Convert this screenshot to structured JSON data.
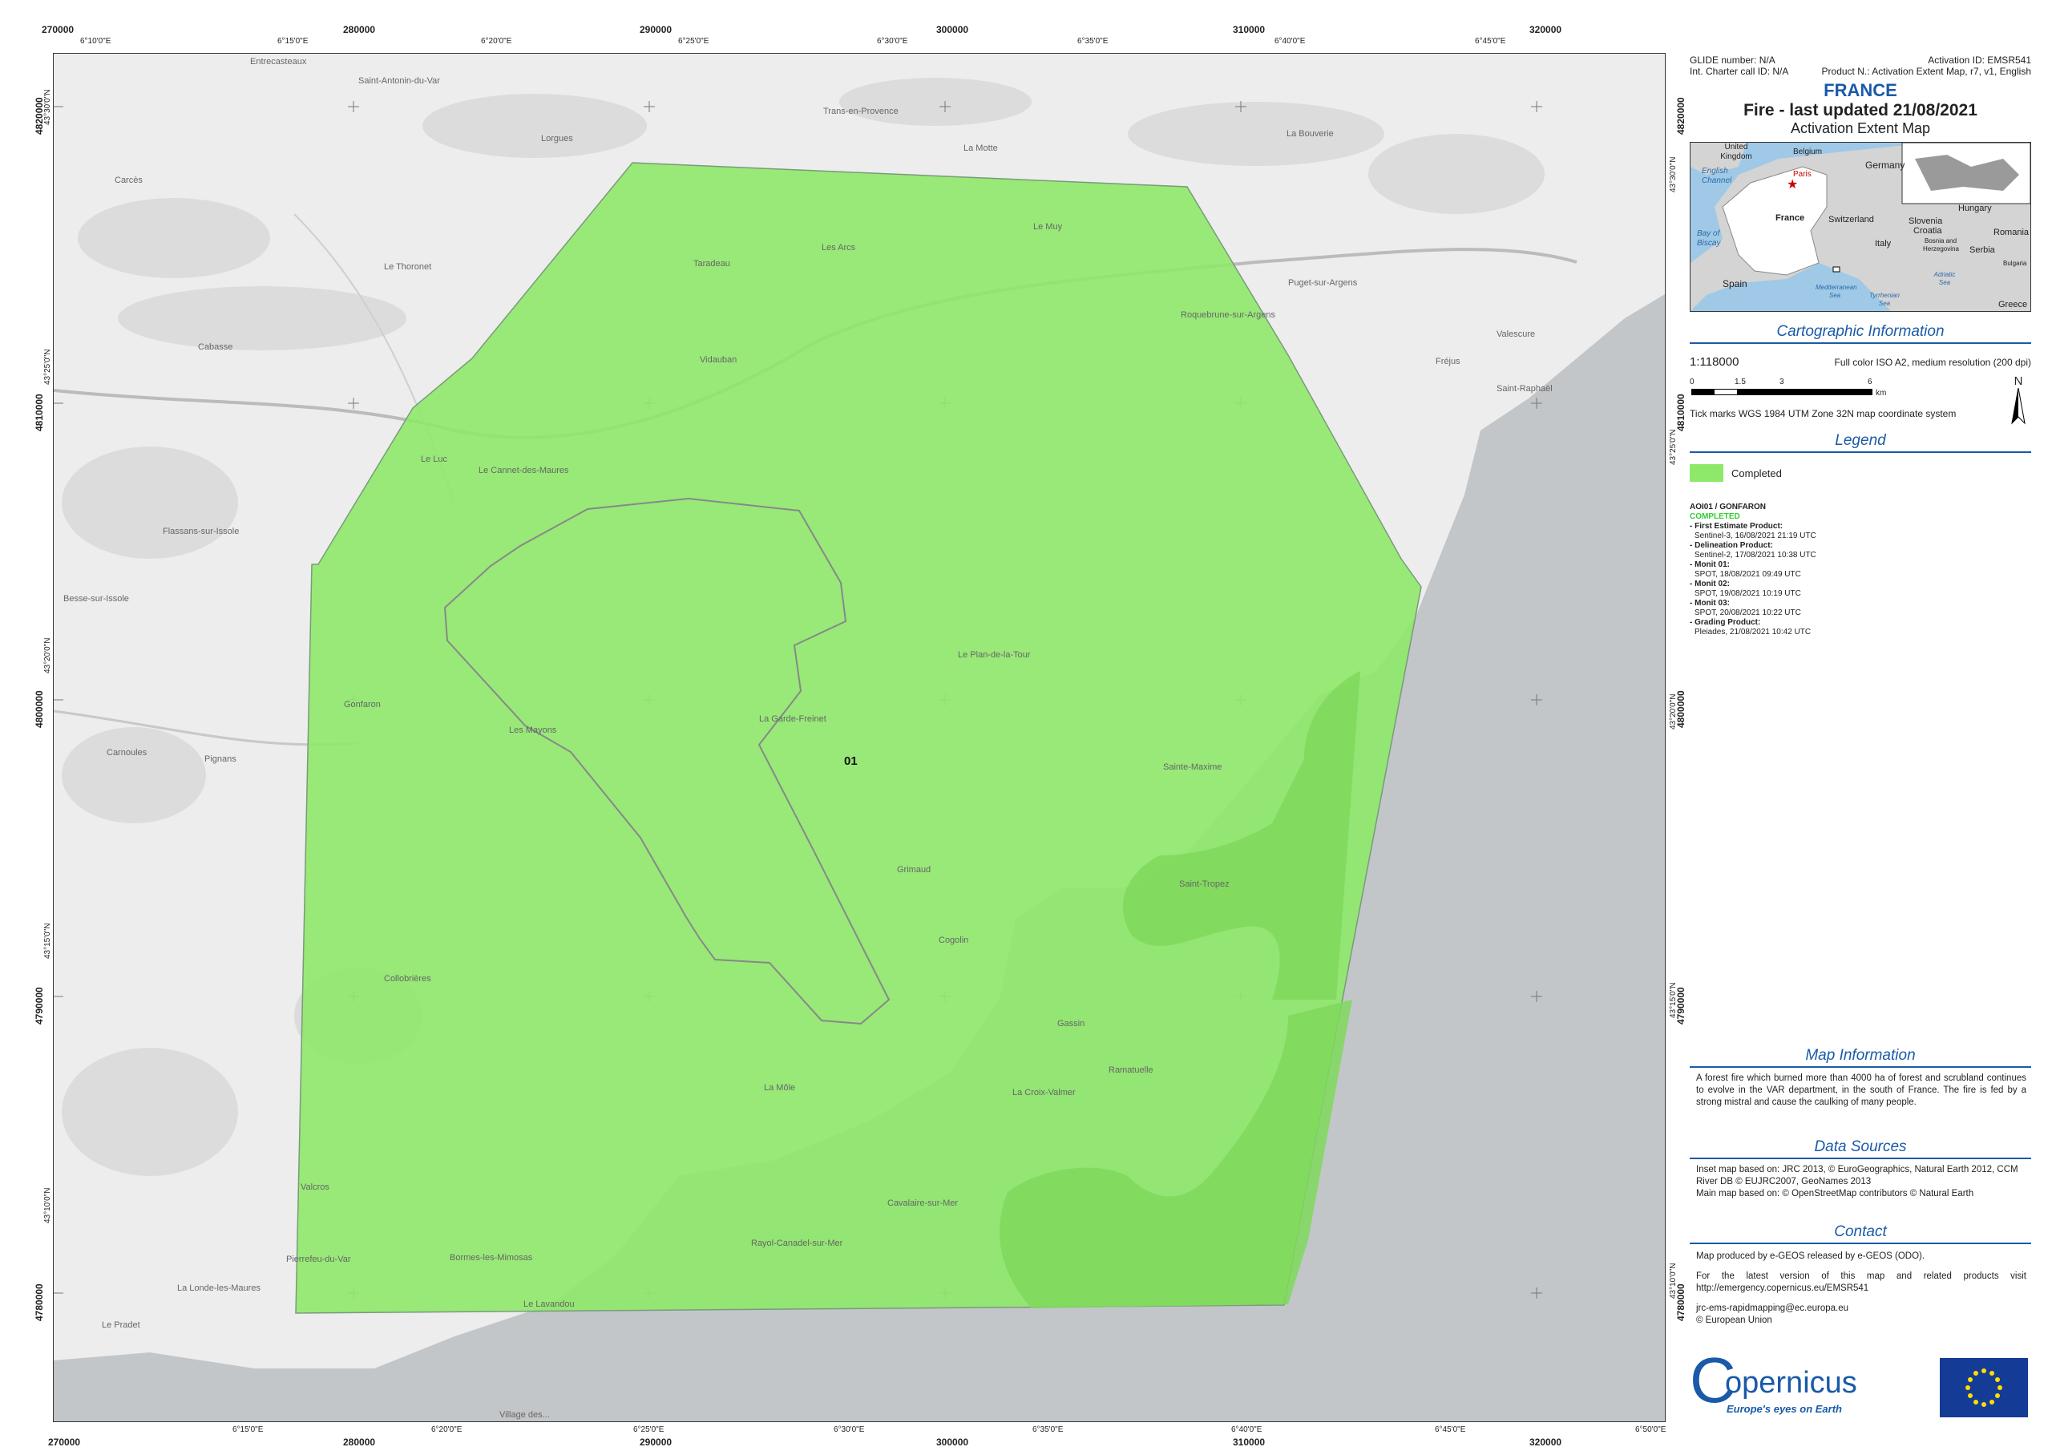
{
  "header": {
    "glide": "GLIDE number: N/A",
    "charter": "Int. Charter call ID: N/A",
    "activation": "Activation ID: EMSR541",
    "product": "Product N.: Activation Extent Map, r7, v1, English",
    "country": "FRANCE",
    "title": "Fire - last updated 21/08/2021",
    "subtitle": "Activation Extent Map"
  },
  "inset": {
    "labels": [
      "United Kingdom",
      "Belgium",
      "Germany",
      "Paris",
      "English Channel",
      "France",
      "Switzerland",
      "Bay of Biscay",
      "Slovenia",
      "Croatia",
      "Hungary",
      "Romania",
      "Italy",
      "Bosnia and Herzegovina",
      "Serbia",
      "Bulgaria",
      "Spain",
      "Mediterranean Sea",
      "Tyrrhenian Sea",
      "Adriatic Sea",
      "Greece"
    ]
  },
  "cartographic": {
    "section_title": "Cartographic Information",
    "scale": "1:118000",
    "print_info": "Full color ISO A2, medium resolution (200 dpi)",
    "scalebar_ticks": [
      "0",
      "1.5",
      "3",
      "6"
    ],
    "scalebar_unit": "km",
    "north": "N",
    "tick_note": "Tick marks WGS 1984 UTM Zone 32N map coordinate system"
  },
  "legend": {
    "section_title": "Legend",
    "item_label": "Completed",
    "item_color": "#8ee86a"
  },
  "aoi": {
    "name": "AOI01 / GONFARON",
    "status": "COMPLETED",
    "status_color": "#33cc33",
    "products": [
      {
        "label": "- First Estimate Product:",
        "detail": "Sentinel-3, 16/08/2021 21:19 UTC"
      },
      {
        "label": "- Delineation Product:",
        "detail": "Sentinel-2, 17/08/2021 10:38 UTC"
      },
      {
        "label": "- Monit 01:",
        "detail": "SPOT, 18/08/2021 09:49 UTC"
      },
      {
        "label": "- Monit 02:",
        "detail": "SPOT, 19/08/2021 10:19 UTC"
      },
      {
        "label": "- Monit 03:",
        "detail": "SPOT, 20/08/2021 10:22 UTC"
      },
      {
        "label": "- Grading Product:",
        "detail": "Pleiades, 21/08/2021 10:42 UTC"
      }
    ]
  },
  "map_info": {
    "section_title": "Map Information",
    "text": "A forest fire which burned more than 4000 ha of forest and scrubland continues to evolve in the VAR department, in the south of France. The fire is fed by a strong mistral and cause the caulking of many people."
  },
  "data_sources": {
    "section_title": "Data Sources",
    "line1": "Inset map based on: JRC 2013, © EuroGeographics, Natural Earth 2012, CCM River DB © EUJRC2007, GeoNames 2013",
    "line2": "Main map based on: © OpenStreetMap contributors © Natural Earth"
  },
  "contact": {
    "section_title": "Contact",
    "produced": "Map produced by e-GEOS released by e-GEOS (ODO).",
    "latest": "For the latest version of this map and related products visit http://emergency.copernicus.eu/EMSR541",
    "email": "jrc-ems-rapidmapping@ec.europa.eu",
    "copyright": "© European Union"
  },
  "logos": {
    "copernicus": "opernicus",
    "copernicus_c": "C",
    "tagline": "Europe's eyes on Earth"
  },
  "map": {
    "aoi_label": "01",
    "top_ticks_utm": [
      "270000",
      "280000",
      "290000",
      "300000",
      "310000",
      "320000"
    ],
    "top_ticks_geo": [
      "6°10'0\"E",
      "6°15'0\"E",
      "6°20'0\"E",
      "6°25'0\"E",
      "6°30'0\"E",
      "6°35'0\"E",
      "6°40'0\"E",
      "6°45'0\"E"
    ],
    "bottom_ticks_utm": [
      "270000",
      "280000",
      "290000",
      "300000",
      "310000",
      "320000"
    ],
    "bottom_ticks_geo": [
      "6°15'0\"E",
      "6°20'0\"E",
      "6°25'0\"E",
      "6°30'0\"E",
      "6°35'0\"E",
      "6°40'0\"E",
      "6°45'0\"E",
      "6°50'0\"E"
    ],
    "left_ticks_utm": [
      "4820000",
      "4810000",
      "4800000",
      "4790000",
      "4780000"
    ],
    "left_ticks_geo": [
      "43°30'0\"N",
      "43°25'0\"N",
      "43°20'0\"N",
      "43°15'0\"N",
      "43°10'0\"N"
    ],
    "place_names": [
      "Entrecasteaux",
      "Saint-Antonin-du-Var",
      "Lorgues",
      "Trans-en-Provence",
      "La Motte",
      "La Bouverie",
      "Carcès",
      "Le Thoronet",
      "Les Arcs",
      "Taradeau",
      "Le Muy",
      "Roquebrune-sur-Argens",
      "Puget-sur-Argens",
      "Fréjus",
      "Valescure",
      "Saint-Raphaël",
      "Cabasse",
      "Vidauban",
      "Le Luc",
      "Le Cannet-des-Maures",
      "Flassans-sur-Issole",
      "Besse-sur-Issole",
      "Gonfaron",
      "Les Mayons",
      "La Garde-Freinet",
      "Le Plan-de-la-Tour",
      "Carnoules",
      "Pignans",
      "Sainte-Maxime",
      "Grimaud",
      "Cogolin",
      "Collobrières",
      "Gassin",
      "Ramatuelle",
      "La Croix-Valmer",
      "La Môle",
      "Cavalaire-sur-Mer",
      "Rayol-Canadel-sur-Mer",
      "Le Lavandou",
      "Bormes-les-Mimosas",
      "Pierrefeu-du-Var",
      "La Londe-les-Maures",
      "Valcros",
      "Le Pradet",
      "Saint-Tropez",
      "Village des..."
    ]
  }
}
